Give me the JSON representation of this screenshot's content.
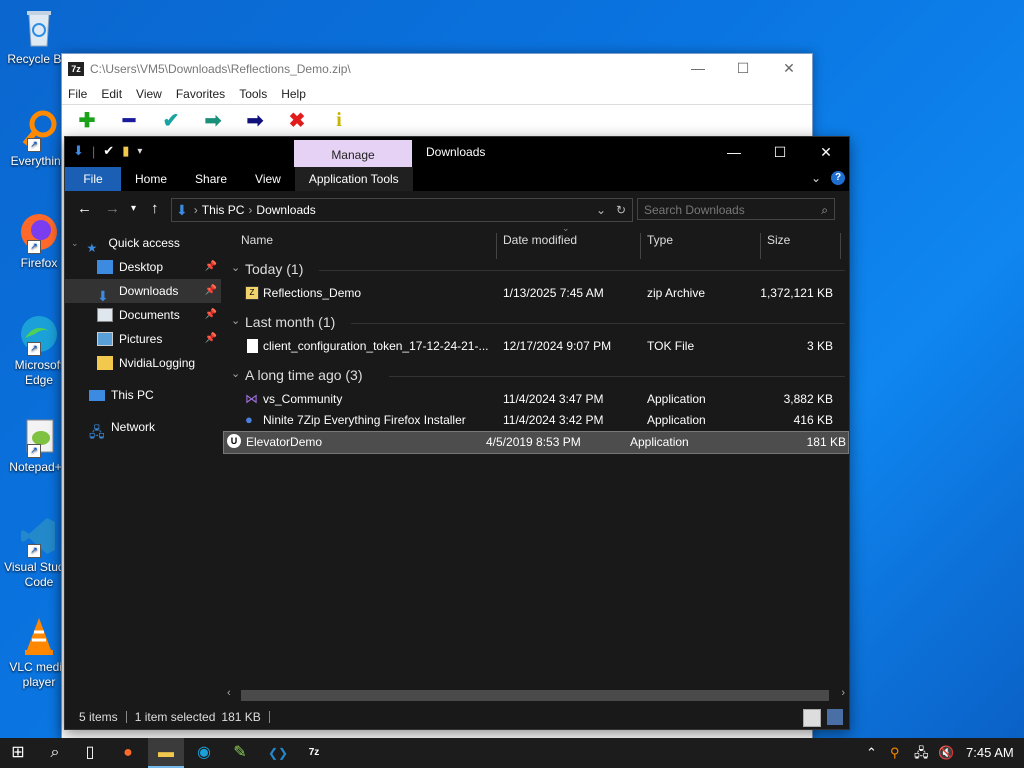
{
  "desktop": {
    "icons": [
      {
        "label": "Recycle Bin",
        "icon": "recycle-bin-icon"
      },
      {
        "label": "Everything",
        "icon": "everything-search-icon"
      },
      {
        "label": "Firefox",
        "icon": "firefox-icon"
      },
      {
        "label": "Microsoft Edge",
        "icon": "edge-icon"
      },
      {
        "label": "Notepad++",
        "icon": "notepad-plus-plus-icon"
      },
      {
        "label": "Visual Studio Code",
        "icon": "vscode-icon"
      },
      {
        "label": "VLC media player",
        "icon": "vlc-icon"
      }
    ]
  },
  "zip_window": {
    "title": "C:\\Users\\VM5\\Downloads\\Reflections_Demo.zip\\",
    "app_icon": "7z",
    "menu": [
      "File",
      "Edit",
      "View",
      "Favorites",
      "Tools",
      "Help"
    ],
    "toolbar": [
      {
        "icon": "add-icon",
        "glyph": "✚",
        "color": "#1aa31a"
      },
      {
        "icon": "extract-icon",
        "glyph": "━",
        "color": "#1a1a9e"
      },
      {
        "icon": "test-icon",
        "glyph": "✔",
        "color": "#1aa3a3"
      },
      {
        "icon": "copy-icon",
        "glyph": "➡",
        "color": "#1a8f7a"
      },
      {
        "icon": "move-icon",
        "glyph": "➡",
        "color": "#10107a"
      },
      {
        "icon": "delete-icon",
        "glyph": "✖",
        "color": "#e21b1b"
      },
      {
        "icon": "info-icon",
        "glyph": "i",
        "color": "#c8b400"
      }
    ]
  },
  "explorer": {
    "title": "Downloads",
    "manage_tab": "Manage",
    "ribbon_tabs": [
      "File",
      "Home",
      "Share",
      "View",
      "Application Tools"
    ],
    "address": [
      "This PC",
      "Downloads"
    ],
    "search_placeholder": "Search Downloads",
    "sidebar": [
      {
        "label": "Quick access",
        "icon": "star-icon",
        "indent": 0,
        "pinned": false
      },
      {
        "label": "Desktop",
        "icon": "desktop-folder-icon",
        "indent": 1,
        "pinned": true
      },
      {
        "label": "Downloads",
        "icon": "download-folder-icon",
        "indent": 1,
        "pinned": true,
        "selected": true
      },
      {
        "label": "Documents",
        "icon": "documents-folder-icon",
        "indent": 1,
        "pinned": true
      },
      {
        "label": "Pictures",
        "icon": "pictures-folder-icon",
        "indent": 1,
        "pinned": true
      },
      {
        "label": "NvidiaLogging",
        "icon": "folder-icon",
        "indent": 1,
        "pinned": false
      },
      {
        "label": "This PC",
        "icon": "computer-icon",
        "indent": 0,
        "pinned": false
      },
      {
        "label": "Network",
        "icon": "network-icon",
        "indent": 0,
        "pinned": false
      }
    ],
    "columns": [
      "Name",
      "Date modified",
      "Type",
      "Size"
    ],
    "groups": [
      {
        "title": "Today (1)",
        "files": [
          {
            "name": "Reflections_Demo",
            "date": "1/13/2025 7:45 AM",
            "type": "zip Archive",
            "size": "1,372,121 KB",
            "icon": "zip-archive-icon"
          }
        ]
      },
      {
        "title": "Last month (1)",
        "files": [
          {
            "name": "client_configuration_token_17-12-24-21-...",
            "date": "12/17/2024 9:07 PM",
            "type": "TOK File",
            "size": "3 KB",
            "icon": "blank-file-icon"
          }
        ]
      },
      {
        "title": "A long time ago (3)",
        "files": [
          {
            "name": "vs_Community",
            "date": "11/4/2024 3:47 PM",
            "type": "Application",
            "size": "3,882 KB",
            "icon": "visual-studio-installer-icon"
          },
          {
            "name": "Ninite 7Zip Everything Firefox Installer",
            "date": "11/4/2024 3:42 PM",
            "type": "Application",
            "size": "416 KB",
            "icon": "ninite-icon"
          },
          {
            "name": "ElevatorDemo",
            "date": "4/5/2019 8:53 PM",
            "type": "Application",
            "size": "181 KB",
            "icon": "unreal-engine-icon",
            "selected": true
          }
        ]
      }
    ],
    "status": {
      "items": "5 items",
      "selected": "1 item selected",
      "selected_size": "181 KB"
    }
  },
  "taskbar": {
    "apps": [
      {
        "icon": "windows-start-icon",
        "glyph": "⊞"
      },
      {
        "icon": "search-icon",
        "glyph": "⌕"
      },
      {
        "icon": "task-view-icon",
        "glyph": "▯"
      },
      {
        "icon": "firefox-icon",
        "glyph": "●"
      },
      {
        "icon": "file-explorer-icon",
        "glyph": "▬",
        "active": true
      },
      {
        "icon": "edge-icon",
        "glyph": "◉"
      },
      {
        "icon": "notepad-plus-plus-icon",
        "glyph": "✎"
      },
      {
        "icon": "vscode-icon",
        "glyph": "❮❯"
      },
      {
        "icon": "7zip-icon",
        "glyph": "7z"
      }
    ],
    "tray_icons": [
      "chevron-up-icon",
      "everything-tray-icon",
      "shield-tray-icon",
      "network-tray-icon",
      "volume-muted-icon"
    ],
    "clock": "7:45 AM"
  }
}
